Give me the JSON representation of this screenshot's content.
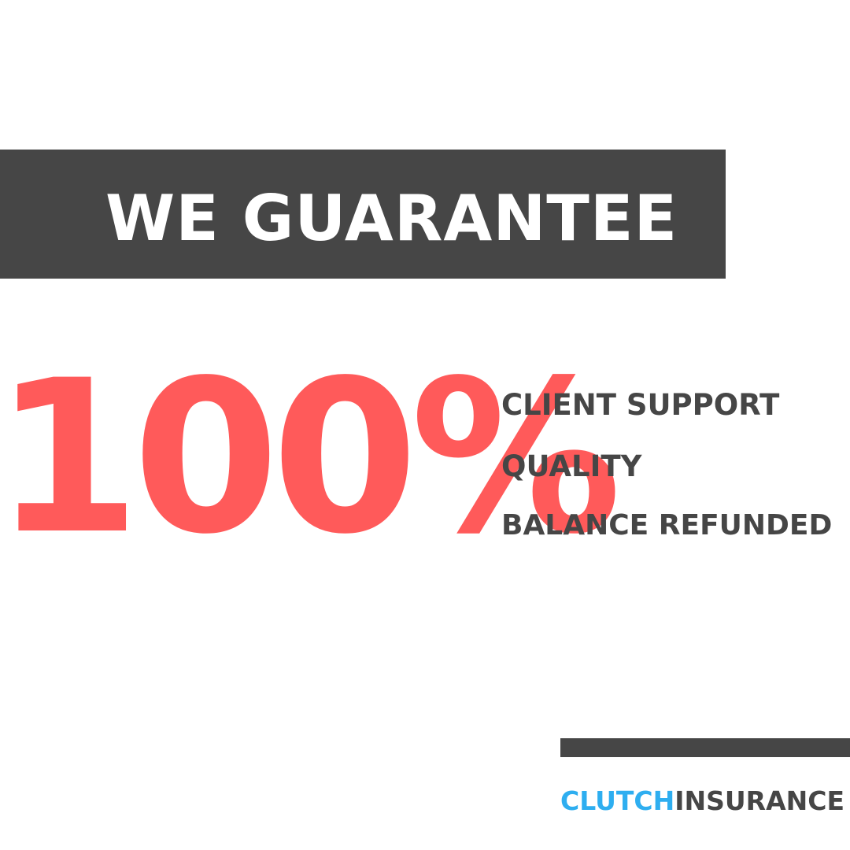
{
  "banner": {
    "title": "WE GUARANTEE"
  },
  "headline": {
    "value": "100%"
  },
  "guarantees": [
    {
      "label": "CLIENT SUPPORT"
    },
    {
      "label": "QUALITY"
    },
    {
      "label": "BALANCE REFUNDED"
    }
  ],
  "brand": {
    "part1": "CLUTCH",
    "part2": "INSURANCE"
  },
  "colors": {
    "background": "#ffffff",
    "banner": "#464646",
    "accent_red": "#ff5a5a",
    "text_dark": "#464646",
    "brand_blue": "#2eaef0"
  }
}
